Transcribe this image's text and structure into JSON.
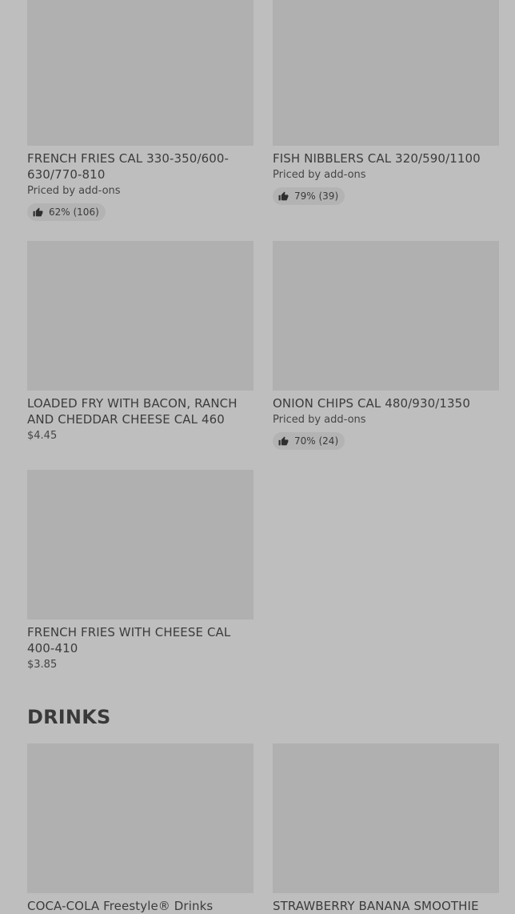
{
  "sections": {
    "drinks_title": "DRINKS"
  },
  "items": [
    {
      "name": "FRENCH FRIES CAL 330-350/600-630/770-810",
      "price": "Priced by add-ons",
      "rating": "62% (106)"
    },
    {
      "name": "FISH NIBBLERS CAL 320/590/1100",
      "price": "Priced by add-ons",
      "rating": "79% (39)"
    },
    {
      "name": "LOADED FRY WITH BACON, RANCH AND CHEDDAR CHEESE CAL 460",
      "price": "$4.45"
    },
    {
      "name": "ONION CHIPS CAL 480/930/1350",
      "price": "Priced by add-ons",
      "rating": "70% (24)"
    },
    {
      "name": "FRENCH FRIES WITH CHEESE CAL 400-410",
      "price": "$3.85"
    }
  ],
  "drinks": [
    {
      "name": "COCA-COLA Freestyle® Drinks"
    },
    {
      "name": "STRAWBERRY BANANA SMOOTHIE"
    }
  ],
  "icons": {
    "rating": "thumbs-up-icon"
  },
  "colors": {
    "page_background": "#bebebe",
    "image_placeholder": "#b0b0b0",
    "rating_pill": "#b3b3b3",
    "text": "#3a3a3a"
  }
}
